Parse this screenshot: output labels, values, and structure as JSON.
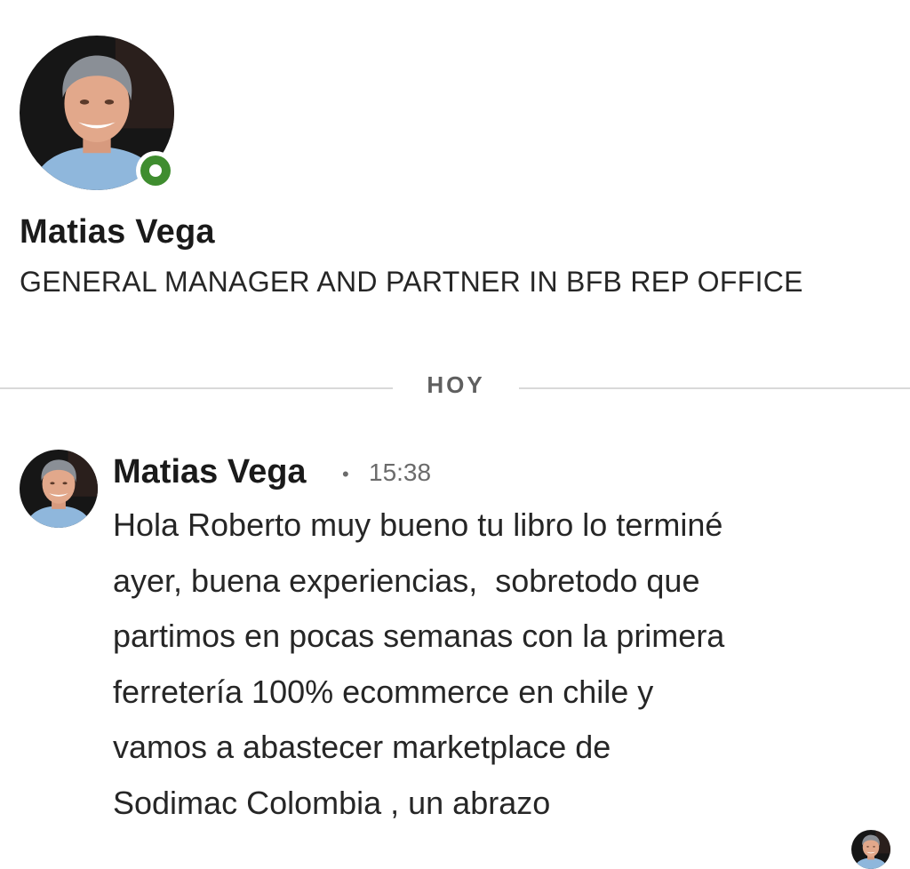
{
  "profile": {
    "name": "Matias Vega",
    "headline": "GENERAL MANAGER AND PARTNER IN BFB REP OFFICE",
    "status": "online",
    "status_color": "#3f8d2f",
    "avatar_icon": "profile-photo"
  },
  "conversation": {
    "date_divider": "HOY",
    "messages": [
      {
        "sender": "Matias Vega",
        "separator": "•",
        "time": "15:38",
        "lines": [
          "Hola Roberto muy bueno tu libro lo terminé",
          "ayer, buena experiencias,  sobretodo que",
          "partimos en pocas semanas con la primera",
          "ferretería 100% ecommerce en chile y",
          "vamos a abastecer marketplace de",
          "Sodimac Colombia , un abrazo"
        ]
      }
    ],
    "read_receipt_icon": "seen-avatar"
  }
}
